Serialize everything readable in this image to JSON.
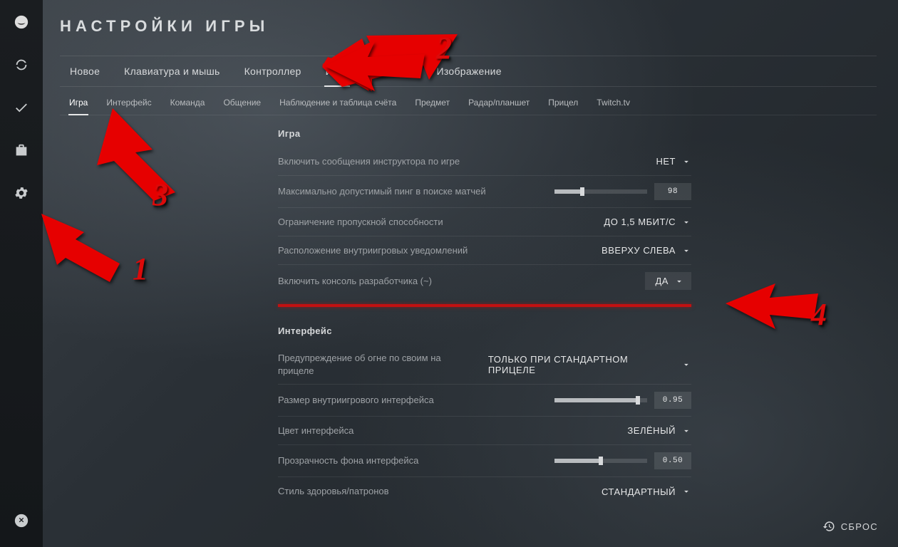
{
  "title": "НАСТРОЙКИ ИГРЫ",
  "primary_tabs": [
    "Новое",
    "Клавиатура и мышь",
    "Контроллер",
    "Игра",
    "Изображение"
  ],
  "primary_active": 3,
  "sub_tabs": [
    "Игра",
    "Интерфейс",
    "Команда",
    "Общение",
    "Наблюдение и таблица счёта",
    "Предмет",
    "Радар/планшет",
    "Прицел",
    "Twitch.tv"
  ],
  "sub_active": 0,
  "sections": {
    "game": {
      "title": "Игра",
      "rows": {
        "instructor": {
          "label": "Включить сообщения инструктора по игре",
          "value": "НЕТ"
        },
        "ping": {
          "label": "Максимально допустимый пинг в поиске матчей",
          "value": "98",
          "fill": 0.3
        },
        "bandwidth": {
          "label": "Ограничение пропускной способности",
          "value": "ДО 1,5 МБИТ/С"
        },
        "notifpos": {
          "label": "Расположение внутриигровых уведомлений",
          "value": "ВВЕРХУ СЛЕВА"
        },
        "devconsole": {
          "label": "Включить консоль разработчика (~)",
          "value": "ДА"
        }
      }
    },
    "hud": {
      "title": "Интерфейс",
      "rows": {
        "ffwarn": {
          "label": "Предупреждение об огне по своим на прицеле",
          "value": "ТОЛЬКО ПРИ СТАНДАРТНОМ ПРИЦЕЛЕ"
        },
        "hudscale": {
          "label": "Размер внутриигрового интерфейса",
          "value": "0.95",
          "fill": 0.9
        },
        "hudcolor": {
          "label": "Цвет интерфейса",
          "value": "ЗЕЛЁНЫЙ"
        },
        "hudalpha": {
          "label": "Прозрачность фона интерфейса",
          "value": "0.50",
          "fill": 0.5
        },
        "healthstyle": {
          "label": "Стиль здоровья/патронов",
          "value": "СТАНДАРТНЫЙ"
        }
      }
    }
  },
  "reset_label": "СБРОС",
  "annotations": {
    "a1": "1",
    "a2": "2",
    "a3": "3",
    "a4": "4"
  }
}
